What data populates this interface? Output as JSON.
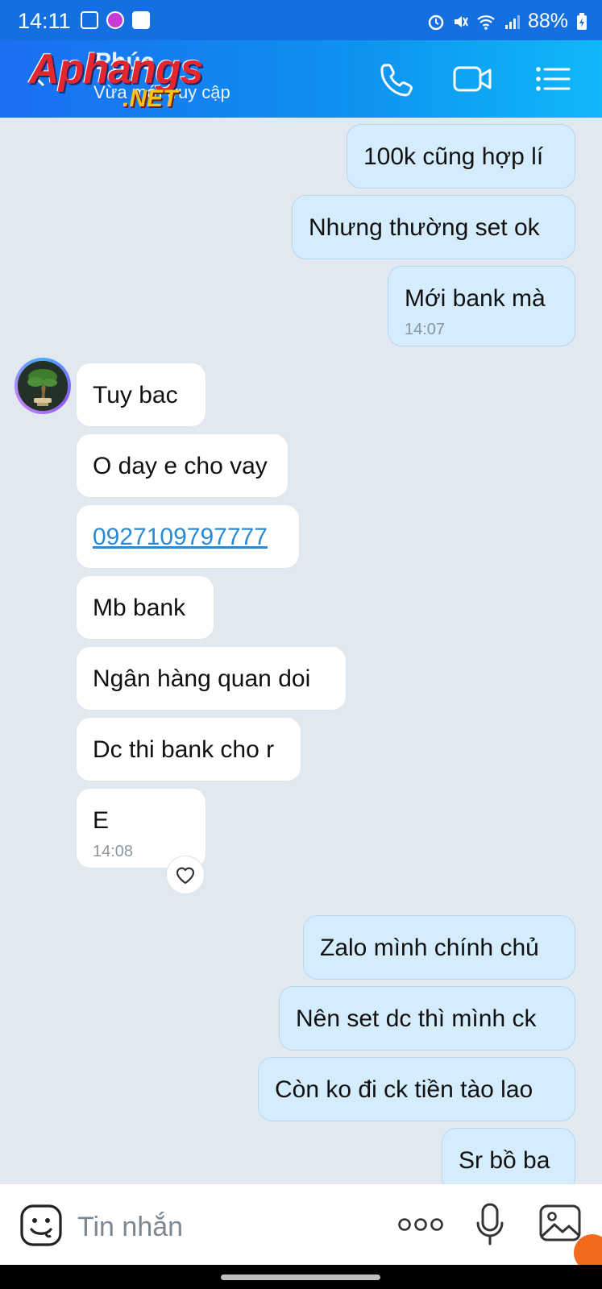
{
  "status_bar": {
    "time": "14:11",
    "battery": "88%"
  },
  "header": {
    "contact_name": "Phúc",
    "contact_status": "Vừa mới truy cập",
    "watermark_top": "Aphangs",
    "watermark_bottom": ".NET"
  },
  "messages": [
    {
      "dir": "out",
      "text": "100k cũng hợp lí"
    },
    {
      "dir": "out",
      "text": "Nhưng thường set ok"
    },
    {
      "dir": "out",
      "text": "Mới bank mà",
      "time": "14:07"
    },
    {
      "dir": "in",
      "text": "Tuy bac"
    },
    {
      "dir": "in",
      "text": "O day e cho vay"
    },
    {
      "dir": "in",
      "text": "0927109797777",
      "link": true
    },
    {
      "dir": "in",
      "text": "Mb bank"
    },
    {
      "dir": "in",
      "text": "Ngân hàng quan doi"
    },
    {
      "dir": "in",
      "text": "Dc thi bank cho r"
    },
    {
      "dir": "in",
      "text": "E",
      "time": "14:08"
    },
    {
      "dir": "out",
      "text": "Zalo mình chính chủ"
    },
    {
      "dir": "out",
      "text": "Nên set dc thì mình ck"
    },
    {
      "dir": "out",
      "text": "Còn ko đi ck tiền tào lao"
    },
    {
      "dir": "out",
      "text": "Sr bồ ba"
    }
  ],
  "input": {
    "placeholder": "Tin nhắn"
  },
  "icons": {
    "back": "back-arrow-icon",
    "call": "phone-icon",
    "video": "video-camera-icon",
    "menu": "list-menu-icon",
    "sticker": "sticker-face-icon",
    "more": "more-dots-icon",
    "mic": "microphone-icon",
    "image": "image-icon",
    "reaction": "heart-icon"
  },
  "colors": {
    "header": "#1a6ef0",
    "outgoing_bubble": "#d5ecfd",
    "incoming_bubble": "#ffffff",
    "chat_bg": "#e2e8f0",
    "link": "#2a8ad4"
  }
}
